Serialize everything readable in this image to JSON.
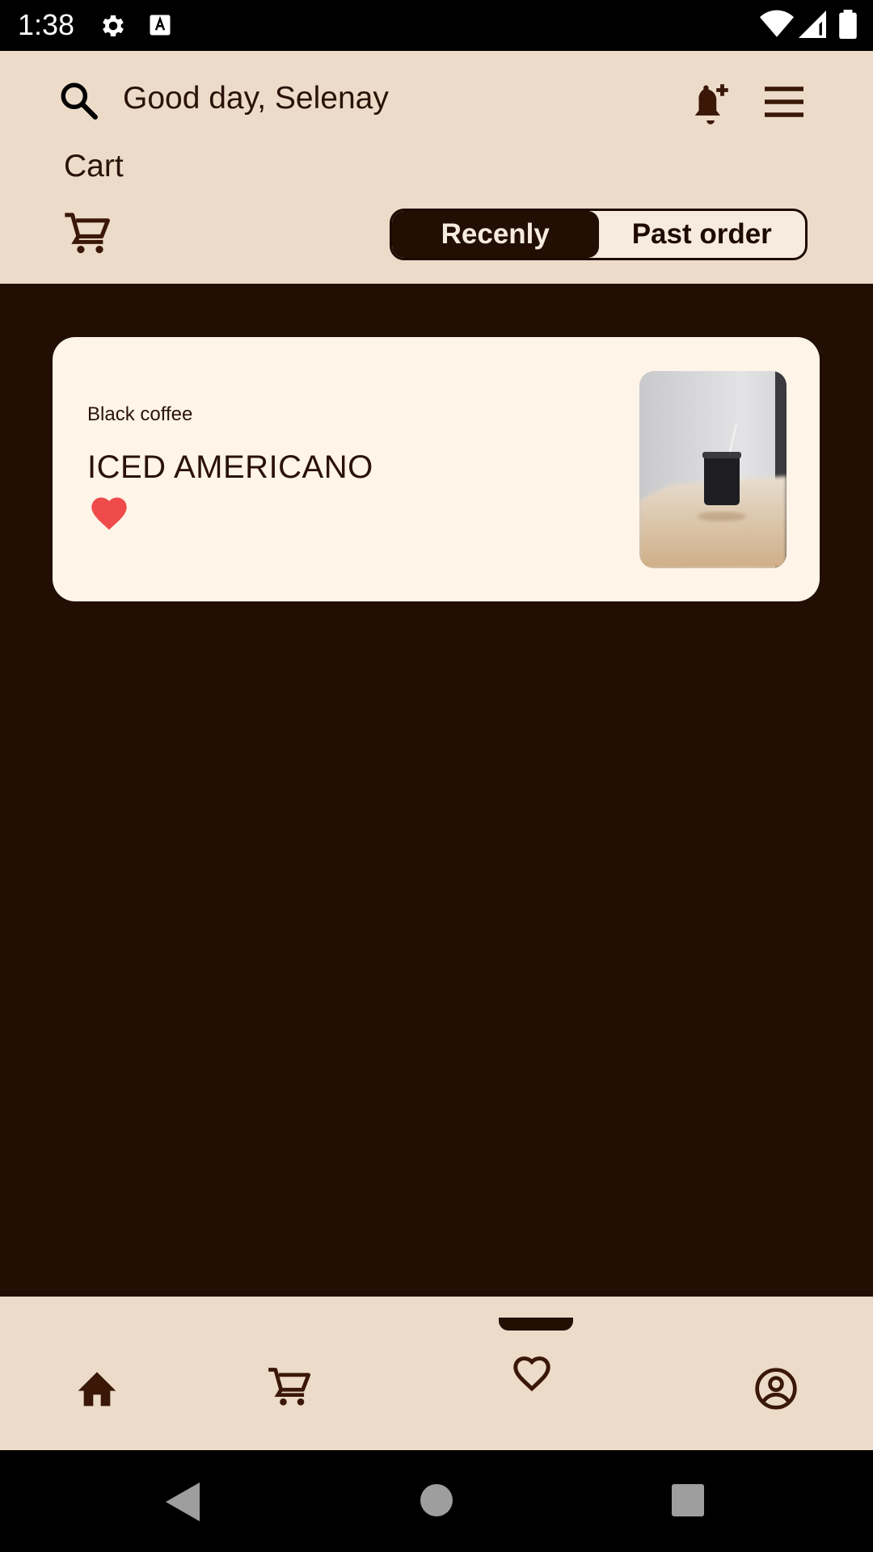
{
  "status_bar": {
    "time": "1:38",
    "icons": [
      "settings-icon",
      "font-a-icon",
      "wifi-icon",
      "signal-icon",
      "battery-icon"
    ]
  },
  "header": {
    "greeting": "Good day, Selenay",
    "title": "Cart",
    "icons": [
      "search-icon",
      "bell-plus-icon",
      "menu-icon",
      "cart-icon"
    ]
  },
  "tabs": {
    "items": [
      {
        "label": "Recenly",
        "active": true
      },
      {
        "label": "Past order",
        "active": false
      }
    ]
  },
  "cart_items": [
    {
      "category": "Black coffee",
      "name": "ICED AMERICANO",
      "favorite": true,
      "image": "iced-americano-photo"
    }
  ],
  "bottom_nav": {
    "items": [
      "home-icon",
      "cart-icon",
      "heart-icon",
      "profile-icon"
    ],
    "selected": "heart-icon"
  },
  "colors": {
    "header_bg": "#ecdbc8",
    "content_bg": "#230e04",
    "card_bg": "#fff4e8",
    "accent_dark": "#230e04",
    "favorite_red": "#ef4b4b"
  }
}
